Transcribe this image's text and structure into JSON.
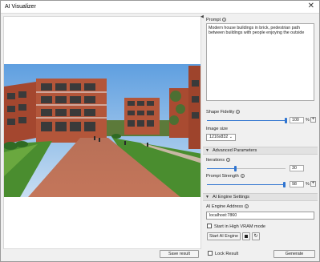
{
  "window": {
    "title": "AI Visualizer",
    "close_glyph": "✕"
  },
  "prompt": {
    "label": "Prompt",
    "text": "Modern house buildings in brick, pedestrian path between buildings with people enjoying the outside"
  },
  "shape_fidelity": {
    "label": "Shape Fidelity",
    "value": "100",
    "unit": "%",
    "level": 1.0
  },
  "image_size": {
    "label": "Image size",
    "selected": "1216x832"
  },
  "advanced": {
    "header": "Advanced Parameters",
    "iterations": {
      "label": "Iterations",
      "value": "30",
      "level": 0.36
    },
    "prompt_strength": {
      "label": "Prompt Strength",
      "value": "98",
      "unit": "%",
      "level": 0.98
    }
  },
  "engine": {
    "header": "AI Engine Settings",
    "address_label": "AI Engine Address",
    "address_value": "localhost:7860",
    "high_vram_label": "Start in High VRAM mode",
    "high_vram_checked": false,
    "start_label": "Start AI Engine"
  },
  "footer": {
    "save_label": "Save result",
    "lock_label": "Lock Result",
    "lock_checked": false,
    "generate_label": "Generate"
  },
  "colors": {
    "accent": "#2f74d0",
    "brick": "#b3563a",
    "lawn": "#4a8d2f",
    "sky": "#8fbce8"
  }
}
